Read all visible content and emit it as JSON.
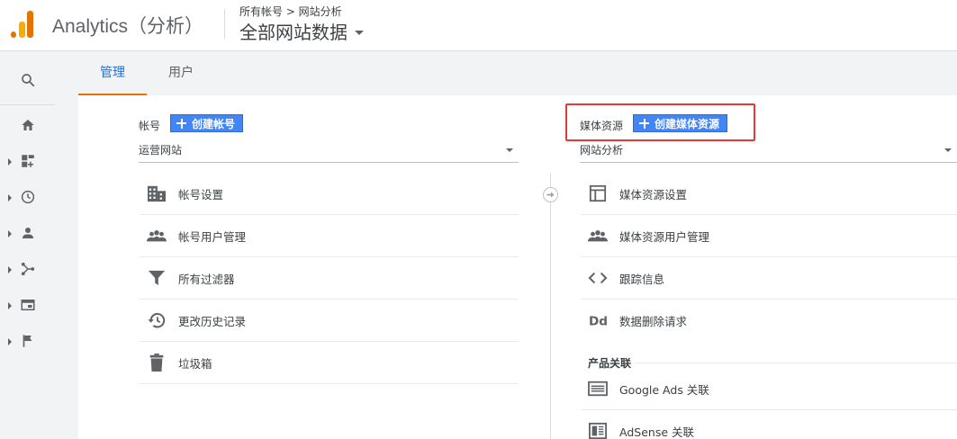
{
  "header": {
    "app_title": "Analytics（分析）",
    "breadcrumb": "所有帐号 > 网站分析",
    "property_selector": "全部网站数据"
  },
  "tabs": [
    {
      "label": "管理"
    },
    {
      "label": "用户"
    }
  ],
  "account_column": {
    "title": "帐号",
    "create_button": "创建帐号",
    "selected": "运营网站",
    "items": [
      {
        "label": "帐号设置",
        "icon": "building-icon"
      },
      {
        "label": "帐号用户管理",
        "icon": "people-icon"
      },
      {
        "label": "所有过滤器",
        "icon": "filter-icon"
      },
      {
        "label": "更改历史记录",
        "icon": "history-icon"
      },
      {
        "label": "垃圾箱",
        "icon": "trash-icon"
      }
    ]
  },
  "property_column": {
    "title": "媒体资源",
    "create_button": "创建媒体资源",
    "selected": "网站分析",
    "items": [
      {
        "label": "媒体资源设置",
        "icon": "layout-icon"
      },
      {
        "label": "媒体资源用户管理",
        "icon": "people-icon"
      },
      {
        "label": "跟踪信息",
        "icon": "code-icon"
      },
      {
        "label": "数据删除请求",
        "icon": "dd-icon"
      }
    ],
    "section_title": "产品关联",
    "product_links": [
      {
        "label": "Google Ads 关联",
        "icon": "google-ads-icon"
      },
      {
        "label": "AdSense 关联",
        "icon": "adsense-icon"
      }
    ]
  },
  "colors": {
    "accent_blue": "#1a73e8",
    "button_blue": "#4285f4",
    "tab_underline": "#e37400",
    "highlight": "#e53935"
  }
}
